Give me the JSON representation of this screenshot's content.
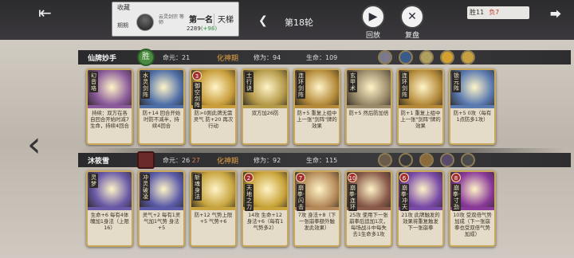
{
  "header": {
    "favorite_label": "收藏",
    "period_label": "期期",
    "sect_label": "云灵剑宗 等师",
    "rank": "第一名",
    "score": "2289",
    "score_gain": "(+98)",
    "ladder_label": "天梯",
    "round_label": "第18轮",
    "replay_label": "回放",
    "review_label": "复盘",
    "wins_label": "胜11",
    "losses_label": "负7"
  },
  "player1": {
    "name": "仙牌妙手",
    "badge": "胜",
    "hp_label": "命元：21",
    "realm": "化神期",
    "cult_label": "修为：94",
    "life_label": "生命：109",
    "cards": [
      {
        "name": "幻音珞",
        "text": "持续：双方在各自回合开始时减7生命，持续4回合",
        "accent": "#8a5a9a"
      },
      {
        "name": "水灵剑阵",
        "text": "防+14 回合开始时防不减半，持续4回合",
        "accent": "#4f6fa8"
      },
      {
        "name": "御空剑阵",
        "cost": "3",
        "text": "防>0则此牌无需灵气 防+20 再次行动",
        "accent": "#c89d3a"
      },
      {
        "name": "土行诀",
        "text": "双方加26防",
        "accent": "#b59a4a"
      },
      {
        "name": "连环剑阵",
        "text": "防+5 重复上组中上一张\"剑阵\"牌的效果",
        "accent": "#b48a3a"
      },
      {
        "name": "玄甲术",
        "text": "防+5 然后防加倍",
        "accent": "#9a8a6a"
      },
      {
        "name": "连环剑阵",
        "text": "防+1 重复上组中上一张\"剑阵\"牌的效果",
        "accent": "#b48a3a"
      },
      {
        "name": "锁元阵",
        "text": "防+5 0攻（每有1点防多1攻）",
        "accent": "#5a7ab0"
      }
    ]
  },
  "player2": {
    "name": "沐筱雪",
    "hp_label": "命元：26",
    "hp_extra": "27",
    "realm": "化神期",
    "cult_label": "修为：92",
    "life_label": "生命：115",
    "cards": [
      {
        "name": "灵梦",
        "text": "生命+6 每有4体魄加1身法（上限16）",
        "accent": "#6a5aa8"
      },
      {
        "name": "冲灵破凌",
        "text": "灵气+2 每有1灵气加1气势 身法+5",
        "accent": "#5a5aa8"
      },
      {
        "name": "斩魂身法",
        "text": "防+12 气势上限+5 气势+6",
        "accent": "#c8a540"
      },
      {
        "name": "天地之力",
        "cost": "2",
        "text": "14攻 生命+12 身法+6（每有1气势多2）",
        "accent": "#c9a43a"
      },
      {
        "name": "崩拳·闪击",
        "cost": "7",
        "text": "7攻 身法+8（下一张崩拳额外触发此效果）",
        "accent": "#b58a5a"
      },
      {
        "name": "崩拳·连环",
        "cost": "10",
        "text": "25攻 使用下一张崩拳后追加1次，每场战斗中每失去1生命多1攻",
        "accent": "#8a5a4a"
      },
      {
        "name": "崩拳·冲天",
        "cost": "6",
        "text": "21攻 此牌触发的效果将重复触发下一张崩拳",
        "accent": "#7a4aa8"
      },
      {
        "name": "崩拳·寸劲",
        "cost": "8",
        "text": "10攻 受双倍气势加成（下一张崩拳也受双倍气势加成）",
        "accent": "#8a3a9a"
      }
    ]
  }
}
